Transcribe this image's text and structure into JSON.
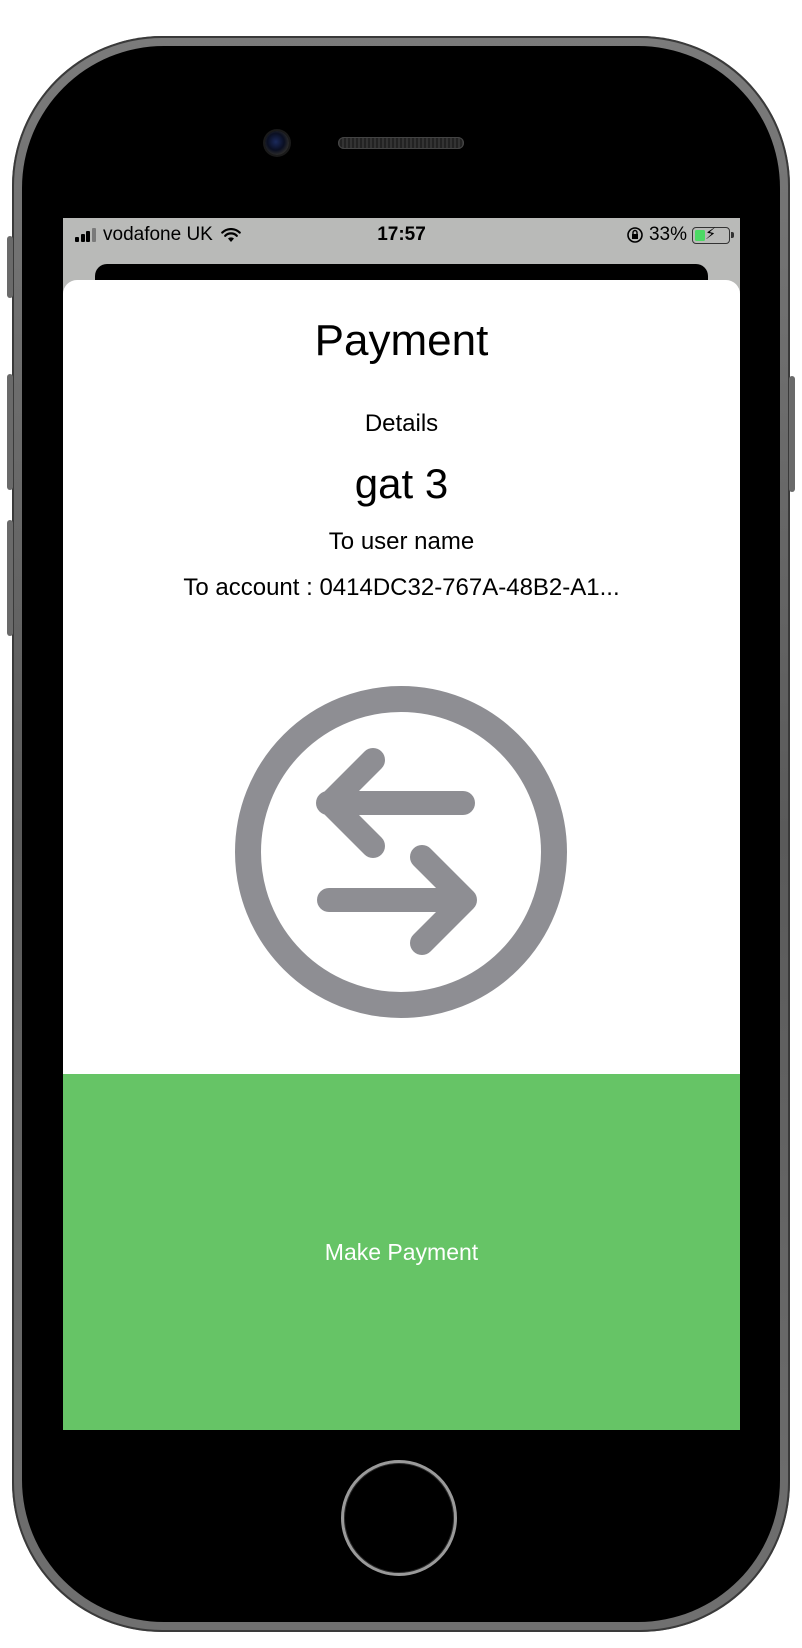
{
  "status_bar": {
    "carrier": "vodafone UK",
    "time": "17:57",
    "battery_percent": "33%",
    "battery_level": 0.33,
    "icons": [
      "signal-icon",
      "wifi-icon",
      "orientation-lock-icon",
      "battery-charging-icon"
    ]
  },
  "payment": {
    "title": "Payment",
    "details_label": "Details",
    "recipient_name": "gat 3",
    "to_user": "To user name",
    "to_account": "To account : 0414DC32-767A-48B2-A1...",
    "icon": "transfer-arrows-icon",
    "make_payment_label": "Make Payment"
  },
  "colors": {
    "button_green": "#66c466",
    "icon_gray": "#8e8e93",
    "battery_green": "#4cd964"
  }
}
